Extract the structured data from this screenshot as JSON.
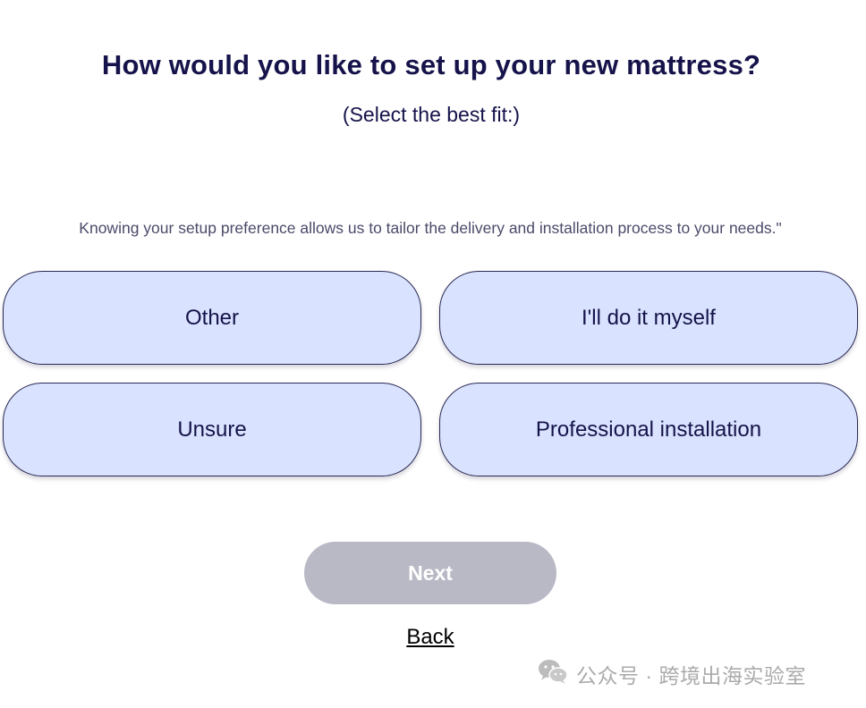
{
  "question": {
    "title": "How would you like to set up your new mattress?",
    "subtitle": "(Select the best fit:)",
    "note": "Knowing your setup preference allows us to tailor the delivery and installation process to your needs.\""
  },
  "options": [
    {
      "label": "Other"
    },
    {
      "label": "I'll do it myself"
    },
    {
      "label": "Unsure"
    },
    {
      "label": "Professional installation"
    }
  ],
  "actions": {
    "next_label": "Next",
    "back_label": "Back"
  },
  "watermark": {
    "icon": "wechat-icon",
    "text": "公众号 · 跨境出海实验室"
  },
  "colors": {
    "text": "#15134a",
    "option_bg": "#d9e2fe",
    "option_border": "#2b2a55",
    "next_disabled_bg": "#b9b9c6"
  }
}
